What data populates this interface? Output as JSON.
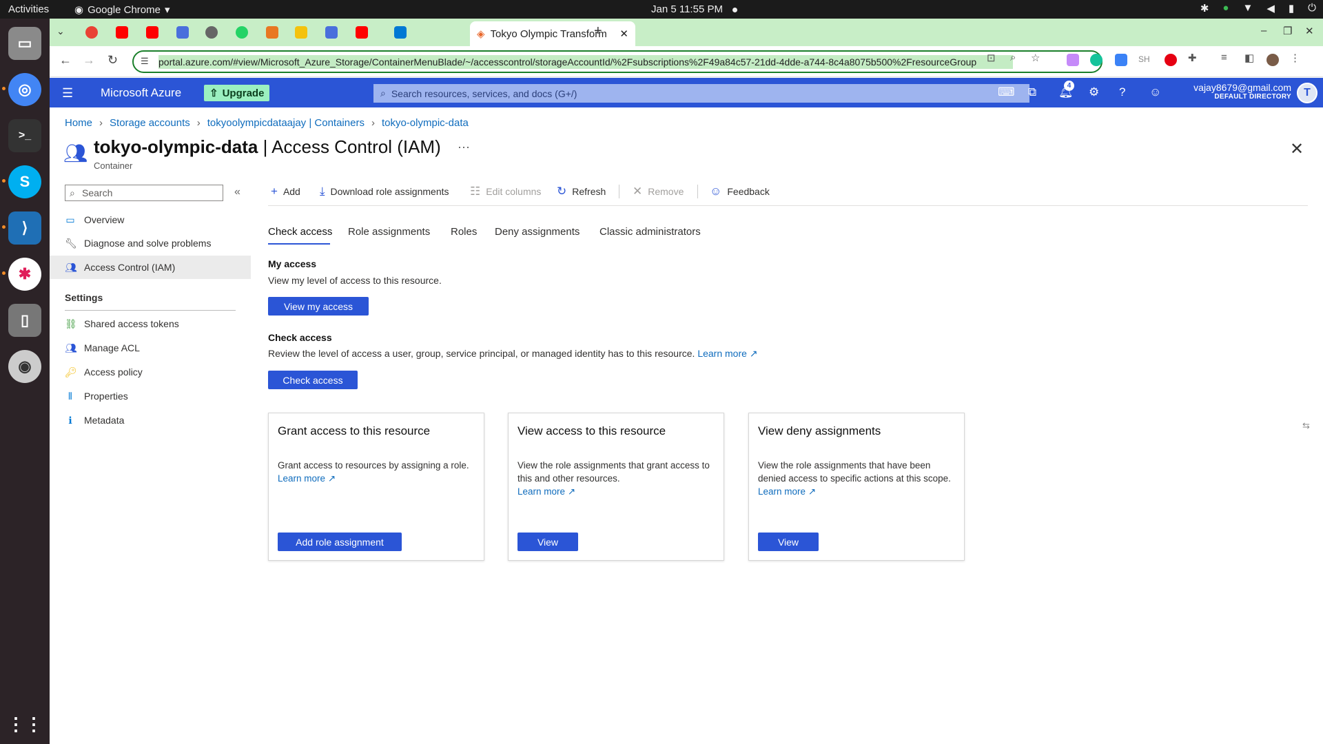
{
  "os": {
    "activities": "Activities",
    "app_name": "Google Chrome",
    "clock": "Jan 5  11:55 PM"
  },
  "browser": {
    "active_tab_title": "Tokyo Olympic Transform",
    "url": "portal.azure.com/#view/Microsoft_Azure_Storage/ContainerMenuBlade/~/accesscontrol/storageAccountId/%2Fsubscriptions%2F49a84c57-21dd-4dde-a744-8c4a8075b500%2FresourceGroup",
    "ext_sh": "SH"
  },
  "azure_header": {
    "brand": "Microsoft Azure",
    "upgrade": "Upgrade",
    "search_placeholder": "Search resources, services, and docs (G+/)",
    "notif_count": "4",
    "email": "vajay8679@gmail.com",
    "directory": "DEFAULT DIRECTORY",
    "avatar_initial": "T"
  },
  "breadcrumb": {
    "home": "Home",
    "storage_accounts": "Storage accounts",
    "account": "tokyoolympicdataajay | Containers",
    "container": "tokyo-olympic-data"
  },
  "page": {
    "title_name": "tokyo-olympic-data",
    "title_suffix": " | Access Control (IAM)",
    "subtitle": "Container",
    "more": "···"
  },
  "sidebar": {
    "search_placeholder": "Search",
    "items": [
      {
        "label": "Overview"
      },
      {
        "label": "Diagnose and solve problems"
      },
      {
        "label": "Access Control (IAM)"
      }
    ],
    "settings_heading": "Settings",
    "settings_items": [
      {
        "label": "Shared access tokens"
      },
      {
        "label": "Manage ACL"
      },
      {
        "label": "Access policy"
      },
      {
        "label": "Properties"
      },
      {
        "label": "Metadata"
      }
    ]
  },
  "commands": {
    "add": "Add",
    "download": "Download role assignments",
    "edit_columns": "Edit columns",
    "refresh": "Refresh",
    "remove": "Remove",
    "feedback": "Feedback"
  },
  "tabs": {
    "check_access": "Check access",
    "role_assignments": "Role assignments",
    "roles": "Roles",
    "deny_assignments": "Deny assignments",
    "classic_admins": "Classic administrators"
  },
  "my_access": {
    "heading": "My access",
    "desc": "View my level of access to this resource.",
    "button": "View my access"
  },
  "check_access": {
    "heading": "Check access",
    "desc": "Review the level of access a user, group, service principal, or managed identity has to this resource.",
    "learn_more": "Learn more",
    "button": "Check access"
  },
  "cards": [
    {
      "title": "Grant access to this resource",
      "desc": "Grant access to resources by assigning a role.",
      "learn_more": "Learn more",
      "button": "Add role assignment"
    },
    {
      "title": "View access to this resource",
      "desc": "View the role assignments that grant access to this and other resources.",
      "learn_more": "Learn more",
      "button": "View"
    },
    {
      "title": "View deny assignments",
      "desc": "View the role assignments that have been denied access to specific actions at this scope.",
      "learn_more": "Learn more",
      "button": "View"
    }
  ],
  "colors": {
    "azure_blue": "#2b55d6",
    "link": "#0f6cbd",
    "tabstrip": "#c8eec7",
    "upgrade_bg": "#9bf0c0"
  }
}
